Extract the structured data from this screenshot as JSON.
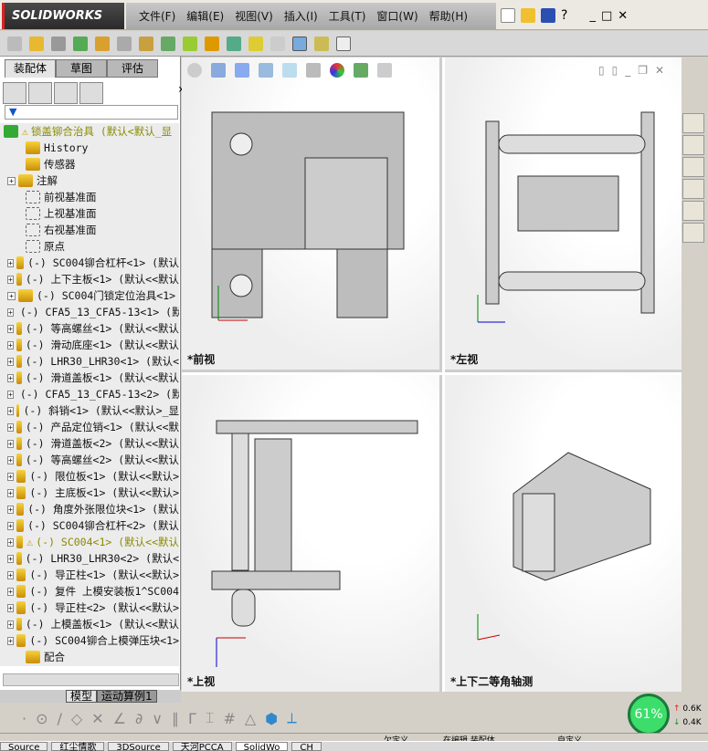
{
  "app": {
    "logo": "SOLIDWORKS"
  },
  "menu": [
    "文件(F)",
    "编辑(E)",
    "视图(V)",
    "插入(I)",
    "工具(T)",
    "窗口(W)",
    "帮助(H)"
  ],
  "panel_tabs": [
    "装配体",
    "草图",
    "评估"
  ],
  "tree": {
    "root": "锁盖铆合治具 (默认<默认_显",
    "items": [
      {
        "label": "History",
        "expand": false
      },
      {
        "label": "传感器",
        "expand": false
      },
      {
        "label": "注解",
        "expand": true
      },
      {
        "label": "前视基准面",
        "expand": false
      },
      {
        "label": "上视基准面",
        "expand": false
      },
      {
        "label": "右视基准面",
        "expand": false
      },
      {
        "label": "原点",
        "expand": false
      },
      {
        "label": "(-) SC004铆合杠杆<1> (默认",
        "expand": true
      },
      {
        "label": "(-) 上下主板<1> (默认<<默认",
        "expand": true
      },
      {
        "label": "(-) SC004门锁定位治具<1>",
        "expand": true
      },
      {
        "label": "(-) CFA5_13_CFA5-13<1> (默",
        "expand": true
      },
      {
        "label": "(-) 等高螺丝<1> (默认<<默认",
        "expand": true
      },
      {
        "label": "(-) 滑动底座<1> (默认<<默认",
        "expand": true
      },
      {
        "label": "(-) LHR30_LHR30<1> (默认<",
        "expand": true
      },
      {
        "label": "(-) 滑道盖板<1> (默认<<默认",
        "expand": true
      },
      {
        "label": "(-) CFA5_13_CFA5-13<2> (默",
        "expand": true
      },
      {
        "label": "(-) 斜销<1> (默认<<默认>_显",
        "expand": true
      },
      {
        "label": "(-) 产品定位销<1> (默认<<默",
        "expand": true
      },
      {
        "label": "(-) 滑道盖板<2> (默认<<默认",
        "expand": true
      },
      {
        "label": "(-) 等高螺丝<2> (默认<<默认",
        "expand": true
      },
      {
        "label": "(-) 限位板<1> (默认<<默认>",
        "expand": true
      },
      {
        "label": "(-) 主底板<1> (默认<<默认>",
        "expand": true
      },
      {
        "label": "(-) 角度外张限位块<1> (默认",
        "expand": true
      },
      {
        "label": "(-) SC004铆合杠杆<2> (默认",
        "expand": true
      },
      {
        "label": "(-) SC004<1> (默认<<默认",
        "expand": true,
        "warning": true
      },
      {
        "label": "(-) LHR30_LHR30<2> (默认<",
        "expand": true
      },
      {
        "label": "(-) 导正柱<1> (默认<<默认>",
        "expand": true
      },
      {
        "label": "(-) 复件 上模安装板1^SC004",
        "expand": true
      },
      {
        "label": "(-) 导正柱<2> (默认<<默认>",
        "expand": true
      },
      {
        "label": "(-) 上模盖板<1> (默认<<默认",
        "expand": true
      },
      {
        "label": "(-) SC004铆合上模弹压块<1>",
        "expand": true
      },
      {
        "label": "配合",
        "expand": false
      }
    ]
  },
  "sheet_tabs": [
    "模型",
    "运动算例1"
  ],
  "views": {
    "front": "*前视",
    "left": "*左视",
    "top": "*上视",
    "iso": "*上下二等角轴测"
  },
  "status": [
    "欠定义",
    "在编辑 装配体",
    "自定义"
  ],
  "gauge": {
    "percent": "61%",
    "up": "0.6K",
    "down": "0.4K"
  },
  "taskbar": [
    "Source",
    "红尘情歌",
    "3DSource",
    "天河PCCA",
    "SolidWo",
    "CH"
  ]
}
